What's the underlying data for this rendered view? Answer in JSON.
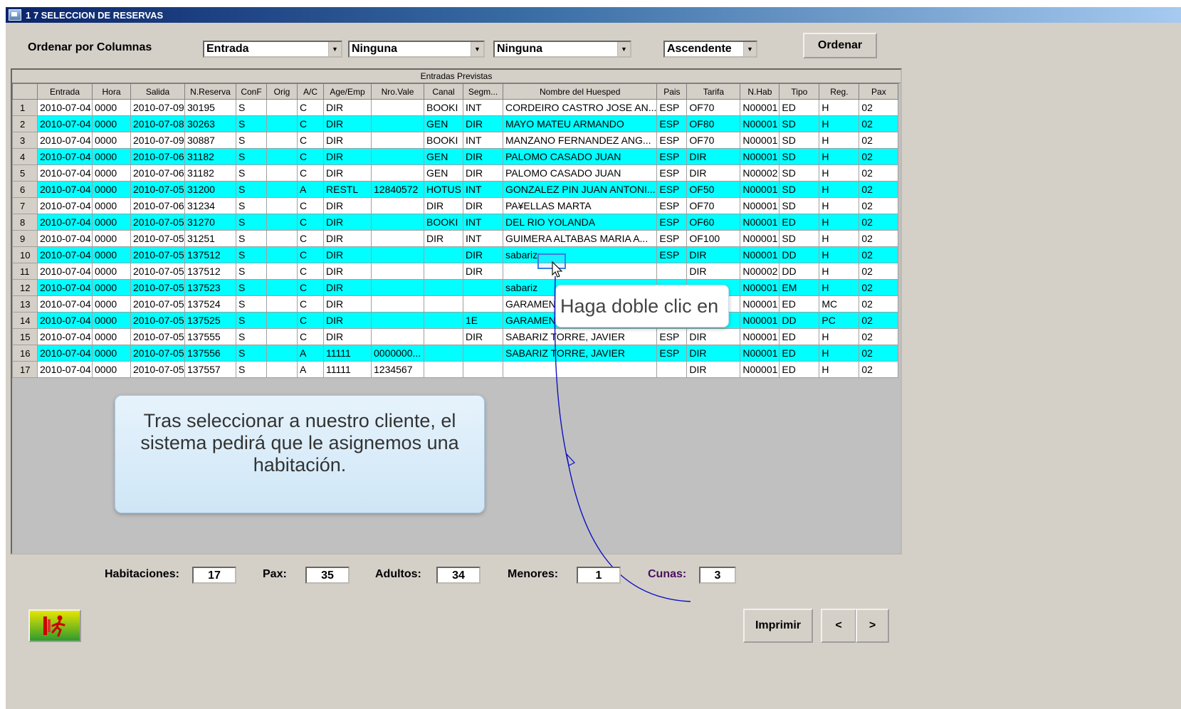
{
  "window": {
    "title": "1 7 SELECCION DE RESERVAS"
  },
  "sort": {
    "label": "Ordenar por Columnas",
    "col1": "Entrada",
    "col2": "Ninguna",
    "col3": "Ninguna",
    "direction": "Ascendente",
    "button": "Ordenar"
  },
  "grid": {
    "caption": "Entradas Previstas",
    "headers": [
      "",
      "Entrada",
      "Hora",
      "Salida",
      "N.Reserva",
      "ConF",
      "Orig",
      "A/C",
      "Age/Emp",
      "Nro.Vale",
      "Canal",
      "Segm...",
      "Nombre del Huesped",
      "Pais",
      "Tarifa",
      "N.Hab",
      "Tipo",
      "Reg.",
      "Pax"
    ],
    "rows": [
      [
        "1",
        "2010-07-04",
        "0000",
        "2010-07-09",
        "30195",
        "S",
        "",
        "C",
        "DIR",
        "",
        "BOOKI",
        "INT",
        "CORDEIRO CASTRO JOSE AN...",
        "ESP",
        "OF70",
        "N00001",
        "ED",
        "H",
        "02"
      ],
      [
        "2",
        "2010-07-04",
        "0000",
        "2010-07-08",
        "30263",
        "S",
        "",
        "C",
        "DIR",
        "",
        "GEN",
        "DIR",
        "MAYO MATEU ARMANDO",
        "ESP",
        "OF80",
        "N00001",
        "SD",
        "H",
        "02"
      ],
      [
        "3",
        "2010-07-04",
        "0000",
        "2010-07-09",
        "30887",
        "S",
        "",
        "C",
        "DIR",
        "",
        "BOOKI",
        "INT",
        "MANZANO FERNANDEZ ANG...",
        "ESP",
        "OF70",
        "N00001",
        "SD",
        "H",
        "02"
      ],
      [
        "4",
        "2010-07-04",
        "0000",
        "2010-07-06",
        "31182",
        "S",
        "",
        "C",
        "DIR",
        "",
        "GEN",
        "DIR",
        "PALOMO CASADO JUAN",
        "ESP",
        "DIR",
        "N00001",
        "SD",
        "H",
        "02"
      ],
      [
        "5",
        "2010-07-04",
        "0000",
        "2010-07-06",
        "31182",
        "S",
        "",
        "C",
        "DIR",
        "",
        "GEN",
        "DIR",
        "PALOMO CASADO JUAN",
        "ESP",
        "DIR",
        "N00002",
        "SD",
        "H",
        "02"
      ],
      [
        "6",
        "2010-07-04",
        "0000",
        "2010-07-05",
        "31200",
        "S",
        "",
        "A",
        "RESTL",
        "12840572",
        "HOTUS",
        "INT",
        "GONZALEZ PIN JUAN ANTONI...",
        "ESP",
        "OF50",
        "N00001",
        "SD",
        "H",
        "02"
      ],
      [
        "7",
        "2010-07-04",
        "0000",
        "2010-07-06",
        "31234",
        "S",
        "",
        "C",
        "DIR",
        "",
        "DIR",
        "DIR",
        "PA¥ELLAS MARTA",
        "ESP",
        "OF70",
        "N00001",
        "SD",
        "H",
        "02"
      ],
      [
        "8",
        "2010-07-04",
        "0000",
        "2010-07-05",
        "31270",
        "S",
        "",
        "C",
        "DIR",
        "",
        "BOOKI",
        "INT",
        "DEL RIO YOLANDA",
        "ESP",
        "OF60",
        "N00001",
        "ED",
        "H",
        "02"
      ],
      [
        "9",
        "2010-07-04",
        "0000",
        "2010-07-05",
        "31251",
        "S",
        "",
        "C",
        "DIR",
        "",
        "DIR",
        "INT",
        "GUIMERA ALTABAS MARIA A...",
        "ESP",
        "OF100",
        "N00001",
        "SD",
        "H",
        "02"
      ],
      [
        "10",
        "2010-07-04",
        "0000",
        "2010-07-05",
        "137512",
        "S",
        "",
        "C",
        "DIR",
        "",
        "",
        "DIR",
        "sabariz",
        "ESP",
        "DIR",
        "N00001",
        "DD",
        "H",
        "02"
      ],
      [
        "11",
        "2010-07-04",
        "0000",
        "2010-07-05",
        "137512",
        "S",
        "",
        "C",
        "DIR",
        "",
        "",
        "DIR",
        "",
        "",
        "DIR",
        "N00002",
        "DD",
        "H",
        "02"
      ],
      [
        "12",
        "2010-07-04",
        "0000",
        "2010-07-05",
        "137523",
        "S",
        "",
        "C",
        "DIR",
        "",
        "",
        "",
        "sabariz",
        "",
        "",
        "N00001",
        "EM",
        "H",
        "02"
      ],
      [
        "13",
        "2010-07-04",
        "0000",
        "2010-07-05",
        "137524",
        "S",
        "",
        "C",
        "DIR",
        "",
        "",
        "",
        "GARAMEND",
        "",
        "",
        "N00001",
        "ED",
        "MC",
        "02"
      ],
      [
        "14",
        "2010-07-04",
        "0000",
        "2010-07-05",
        "137525",
        "S",
        "",
        "C",
        "DIR",
        "",
        "",
        "1E",
        "GARAMEND",
        "",
        "",
        "N00001",
        "DD",
        "PC",
        "02"
      ],
      [
        "15",
        "2010-07-04",
        "0000",
        "2010-07-05",
        "137555",
        "S",
        "",
        "C",
        "DIR",
        "",
        "",
        "DIR",
        "SABARIZ TORRE, JAVIER",
        "ESP",
        "DIR",
        "N00001",
        "ED",
        "H",
        "02"
      ],
      [
        "16",
        "2010-07-04",
        "0000",
        "2010-07-05",
        "137556",
        "S",
        "",
        "A",
        "11111",
        "0000000...",
        "",
        "",
        "SABARIZ TORRE, JAVIER",
        "ESP",
        "DIR",
        "N00001",
        "ED",
        "H",
        "02"
      ],
      [
        "17",
        "2010-07-04",
        "0000",
        "2010-07-05",
        "137557",
        "S",
        "",
        "A",
        "11111",
        "1234567",
        "",
        "",
        "",
        "",
        "DIR",
        "N00001",
        "ED",
        "H",
        "02"
      ]
    ],
    "row_colors": [
      "white",
      "cyan",
      "white",
      "cyan",
      "white",
      "cyan",
      "white",
      "cyan",
      "white",
      "cyan",
      "white",
      "cyan",
      "white",
      "cyan",
      "white",
      "cyan",
      "white"
    ]
  },
  "tooltip_text": "Tras seleccionar a nuestro cliente, el sistema pedirá que le asignemos una habitación.",
  "bubble_text": "Haga doble clic en",
  "totals": {
    "habitaciones_label": "Habitaciones:",
    "habitaciones": "17",
    "pax_label": "Pax:",
    "pax": "35",
    "adultos_label": "Adultos:",
    "adultos": "34",
    "menores_label": "Menores:",
    "menores": "1",
    "cunas_label": "Cunas:",
    "cunas": "3"
  },
  "buttons": {
    "print": "Imprimir",
    "prev": "<",
    "next": ">"
  },
  "icons": {
    "title_icon": "app-icon",
    "exit": "exit-icon",
    "cursor": "mouse-cursor-icon"
  },
  "colors": {
    "row_highlight": "#00ffff",
    "annotation": "#1010c0",
    "cunas_label": "#4b0f5e"
  }
}
